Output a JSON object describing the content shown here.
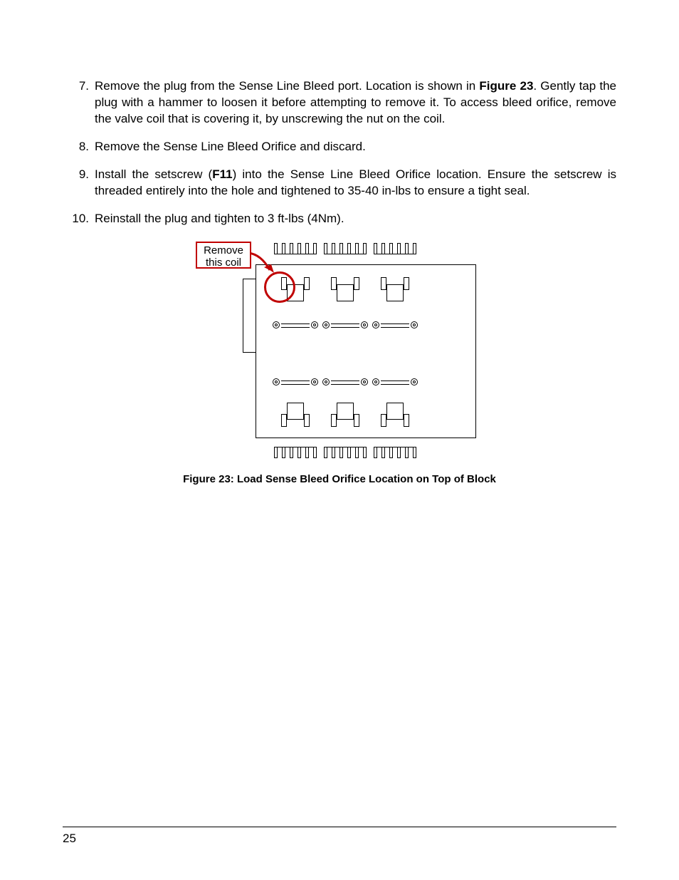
{
  "steps": [
    {
      "num": "7.",
      "segments": [
        {
          "t": "Remove the plug from the Sense Line Bleed port.  Location is shown in ",
          "b": false
        },
        {
          "t": "Figure 23",
          "b": true
        },
        {
          "t": ".  Gently tap the plug with a hammer to loosen it before attempting to remove it.  To access bleed orifice, remove the valve coil that is covering it, by unscrewing the nut on the coil.",
          "b": false
        }
      ]
    },
    {
      "num": "8.",
      "segments": [
        {
          "t": "Remove the Sense Line Bleed Orifice and discard.",
          "b": false
        }
      ]
    },
    {
      "num": "9.",
      "segments": [
        {
          "t": "Install the setscrew (",
          "b": false
        },
        {
          "t": "F11",
          "b": true
        },
        {
          "t": ") into the Sense Line Bleed Orifice location.  Ensure the setscrew is threaded entirely into the hole and tightened to 35-40 in-lbs to ensure a tight seal.",
          "b": false
        }
      ]
    },
    {
      "num": "10.",
      "segments": [
        {
          "t": "Reinstall the plug and tighten to 3 ft-lbs (4Nm).",
          "b": false
        }
      ]
    }
  ],
  "callout": {
    "line1": "Remove",
    "line2": "this coil"
  },
  "figure_caption": "Figure 23: Load Sense Bleed Orifice Location on Top of Block",
  "page_number": "25",
  "colors": {
    "red": "#c00000"
  }
}
